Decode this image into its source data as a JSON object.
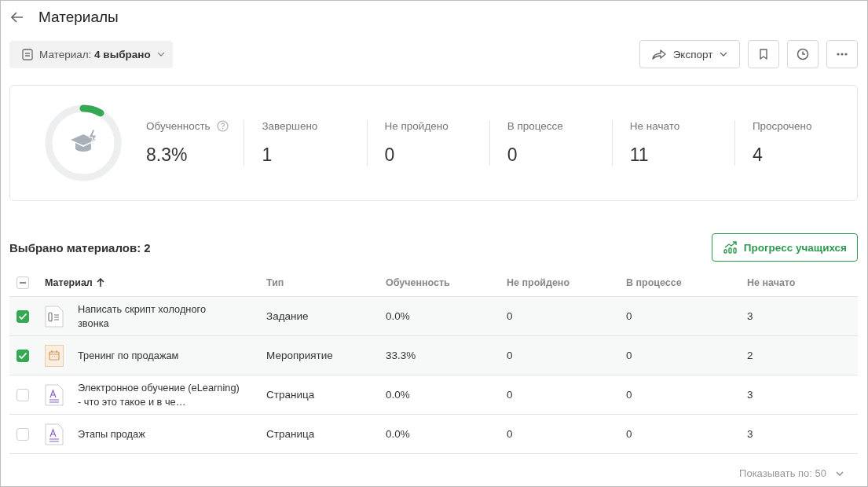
{
  "page": {
    "title": "Материалы"
  },
  "filter": {
    "label": "Материал:",
    "value": "4 выбрано"
  },
  "toolbar": {
    "export": "Экспорт"
  },
  "summary": {
    "level": 0.083,
    "stats": [
      {
        "label": "Обученность",
        "value": "8.3%",
        "help": true
      },
      {
        "label": "Завершено",
        "value": "1",
        "help": false
      },
      {
        "label": "Не пройдено",
        "value": "0",
        "help": false
      },
      {
        "label": "В процессе",
        "value": "0",
        "help": false
      },
      {
        "label": "Не начато",
        "value": "11",
        "help": false
      },
      {
        "label": "Просрочено",
        "value": "4",
        "help": false
      }
    ]
  },
  "selection": {
    "title": "Выбрано материалов: 2",
    "button": "Прогресс учащихся"
  },
  "table": {
    "indeterminate": true,
    "columns": [
      {
        "label": "Материал",
        "sorted": true
      },
      {
        "label": "Тип",
        "sorted": false
      },
      {
        "label": "Обученность",
        "sorted": false
      },
      {
        "label": "Не пройдено",
        "sorted": false
      },
      {
        "label": "В процессе",
        "sorted": false
      },
      {
        "label": "Не начато",
        "sorted": false
      }
    ],
    "rows": [
      {
        "kind": "task",
        "checked": true,
        "name": "Написать скрипт холодного звонка",
        "type": "Задание",
        "progress": "0.0%",
        "failed": "0",
        "in_progress": "0",
        "not_started": "3"
      },
      {
        "kind": "event",
        "checked": true,
        "name": "Тренинг по продажам",
        "type": "Мероприятие",
        "progress": "33.3%",
        "failed": "0",
        "in_progress": "0",
        "not_started": "2"
      },
      {
        "kind": "page",
        "checked": false,
        "name": "Электронное обучение (eLearning) - что это такое и в че…",
        "type": "Страница",
        "progress": "0.0%",
        "failed": "0",
        "in_progress": "0",
        "not_started": "3"
      },
      {
        "kind": "page",
        "checked": false,
        "name": "Этапы продаж",
        "type": "Страница",
        "progress": "0.0%",
        "failed": "0",
        "in_progress": "0",
        "not_started": "3"
      }
    ]
  },
  "footer": {
    "page_size": "Показывать по: 50"
  }
}
